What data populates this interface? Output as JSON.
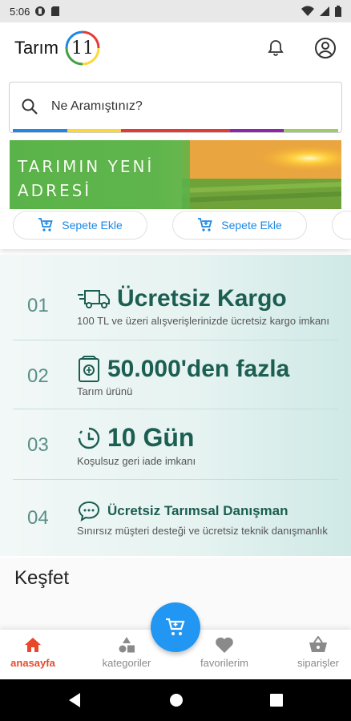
{
  "status_bar": {
    "time": "5:06"
  },
  "header": {
    "brand_text": "Tarım",
    "logo_number": "11"
  },
  "search": {
    "placeholder": "Ne Aramıştınız?"
  },
  "banner": {
    "line1": "TARIMIN YENİ",
    "line2": "ADRESİ"
  },
  "products": {
    "add_to_cart_label": "Sepete Ekle"
  },
  "features": [
    {
      "number": "01",
      "title": "Ücretsiz Kargo",
      "description": "100 TL ve üzeri alışverişlerinizde ücretsiz kargo imkanı",
      "icon": "truck-icon"
    },
    {
      "number": "02",
      "title": "50.000'den fazla",
      "description": "Tarım ürünü",
      "icon": "product-box-icon"
    },
    {
      "number": "03",
      "title": "10 Gün",
      "description": "Koşulsuz geri iade imkanı",
      "icon": "clock-icon"
    },
    {
      "number": "04",
      "title": "Ücretsiz Tarımsal Danışman",
      "description": "Sınırsız müşteri desteği ve ücretsiz teknik danışmanlık",
      "icon": "chat-icon"
    }
  ],
  "discover": {
    "title": "Keşfet"
  },
  "bottom_nav": [
    {
      "label": "anasayfa",
      "icon": "home-icon",
      "active": true
    },
    {
      "label": "kategoriler",
      "icon": "categories-icon",
      "active": false
    },
    {
      "label": "favorilerim",
      "icon": "heart-icon",
      "active": false
    },
    {
      "label": "siparişler",
      "icon": "basket-icon",
      "active": false
    }
  ],
  "colors": {
    "accent_blue": "#2196f3",
    "active_red": "#e8492a",
    "feature_green": "#1c5e52"
  }
}
